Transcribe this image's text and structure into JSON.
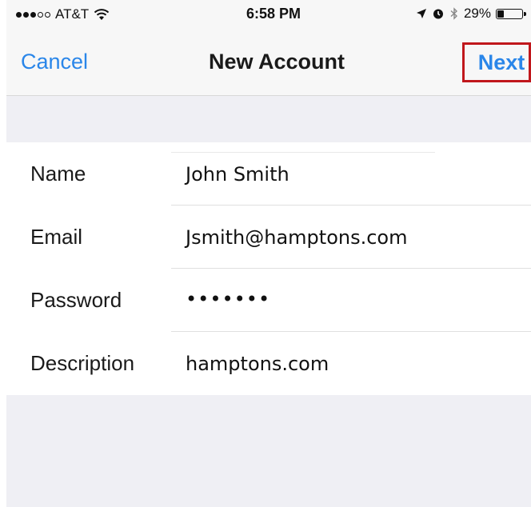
{
  "status_bar": {
    "carrier": "AT&T",
    "time": "6:58 PM",
    "battery_percent_text": "29%",
    "battery_level": 0.29
  },
  "nav": {
    "cancel_label": "Cancel",
    "title": "New Account",
    "next_label": "Next"
  },
  "form": {
    "rows": [
      {
        "label": "Name",
        "value": "John Smith"
      },
      {
        "label": "Email",
        "value": "Jsmith@hamptons.com"
      },
      {
        "label": "Password",
        "value": "•••••••"
      },
      {
        "label": "Description",
        "value": "hamptons.com"
      }
    ]
  },
  "icons": [
    "wifi-icon",
    "location-arrow-icon",
    "alarm-icon",
    "bluetooth-icon",
    "battery-icon"
  ],
  "colors": {
    "accent": "#2a86e9",
    "highlight_box": "#c0171c",
    "group_background": "#efeff4"
  }
}
